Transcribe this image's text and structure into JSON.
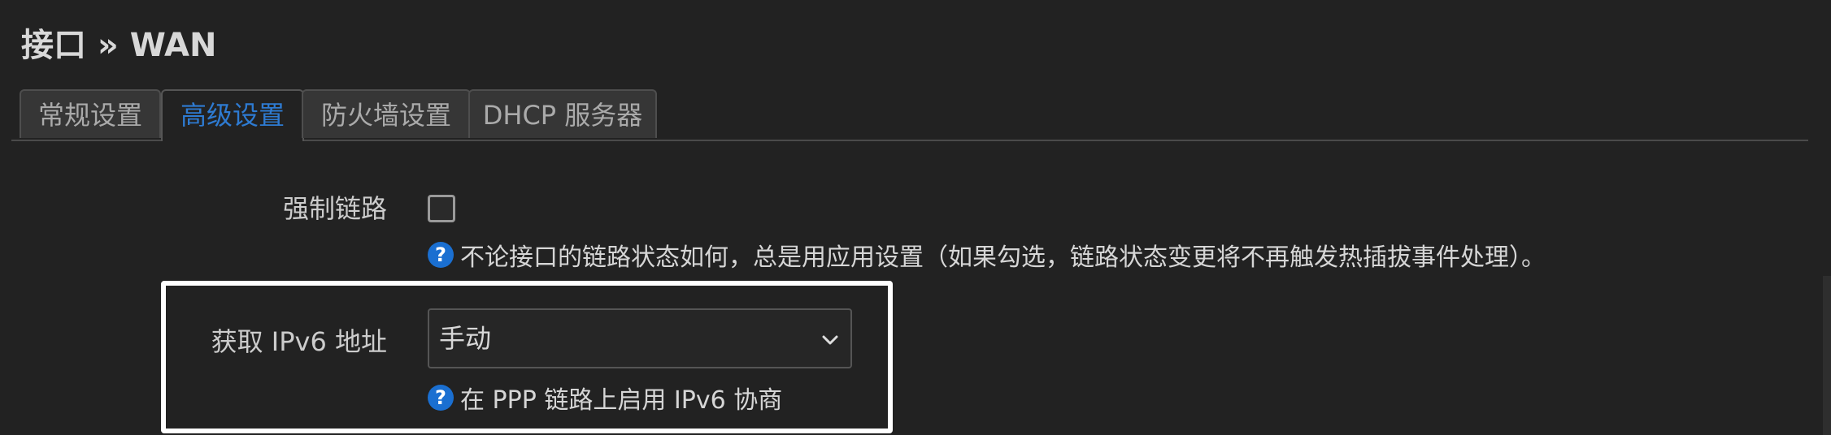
{
  "page": {
    "title": "接口 » WAN"
  },
  "tabs": [
    {
      "label": "常规设置",
      "active": false
    },
    {
      "label": "高级设置",
      "active": true
    },
    {
      "label": "防火墙设置",
      "active": false
    },
    {
      "label": "DHCP 服务器",
      "active": false
    }
  ],
  "force_link": {
    "label": "强制链路",
    "checked": false,
    "help": "不论接口的链路状态如何，总是用应用设置（如果勾选，链路状态变更将不再触发热插拔事件处理）。"
  },
  "ipv6": {
    "label": "获取 IPv6 地址",
    "selected": "手动",
    "help": "在 PPP 链路上启用 IPv6 协商"
  },
  "icons": {
    "help": "help-icon",
    "select_arrow": "chevron-down-icon"
  },
  "colors": {
    "background": "#222222",
    "active_tab": "#2e7bd2",
    "help_icon": "#1a6fd1",
    "highlight_border": "#ffffff"
  }
}
